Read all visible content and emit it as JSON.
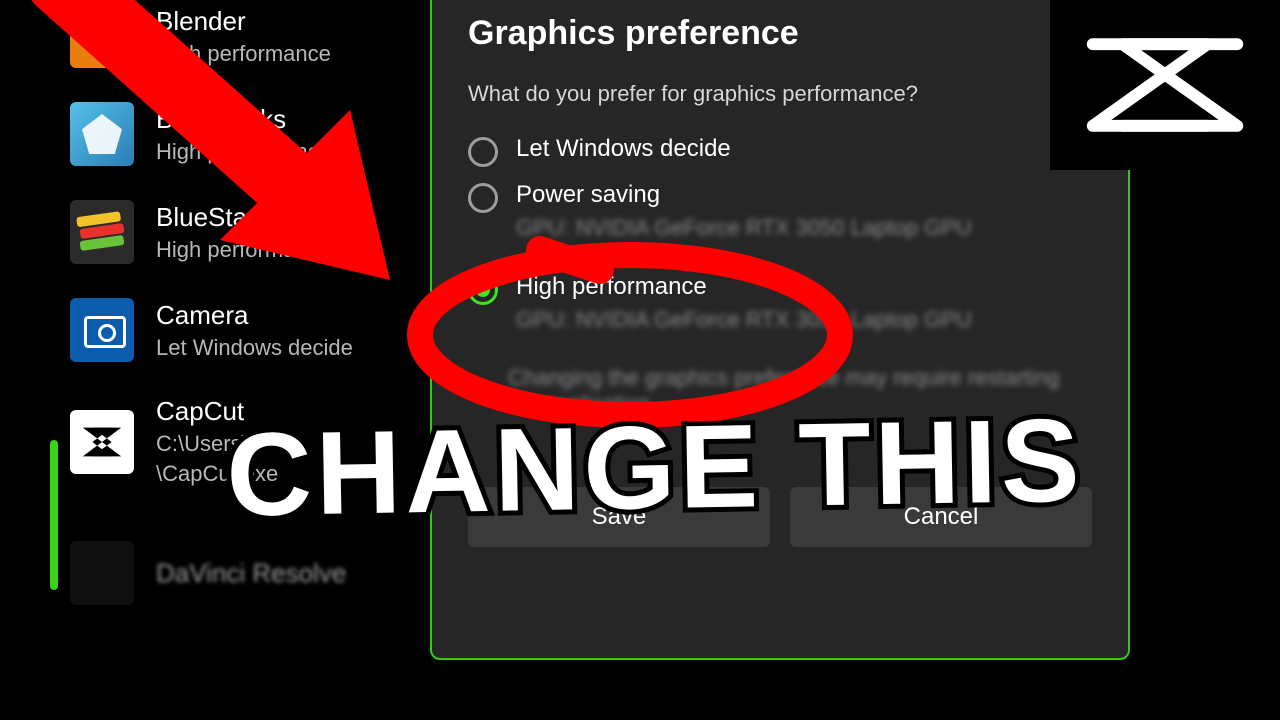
{
  "apps": {
    "blender": {
      "name": "Blender",
      "sub": "High performance"
    },
    "bluestacks": {
      "name": "BlueStacks",
      "sub": "High performance"
    },
    "bluestacks2": {
      "name": "BlueStacks",
      "sub": "High performance"
    },
    "camera": {
      "name": "Camera",
      "sub": "Let Windows decide"
    },
    "capcut": {
      "name": "CapCut",
      "sub": "C:\\Users\\...",
      "sub2": "\\CapCut.exe"
    },
    "davinci": {
      "name": "DaVinci Resolve",
      "sub": ""
    }
  },
  "dialog": {
    "title": "Graphics preference",
    "question": "What do you prefer for graphics performance?",
    "options": {
      "auto": {
        "label": "Let Windows decide"
      },
      "power": {
        "label": "Power saving",
        "gpu": "GPU: NVIDIA GeForce RTX 3050 Laptop GPU"
      },
      "perf": {
        "label": "High performance",
        "gpu": "GPU: NVIDIA GeForce RTX 3050 Laptop GPU"
      }
    },
    "description": "Changing the graphics preference may require restarting the application.",
    "save": "Save",
    "cancel": "Cancel"
  },
  "overlay": {
    "headline": "CHANGE THIS"
  }
}
